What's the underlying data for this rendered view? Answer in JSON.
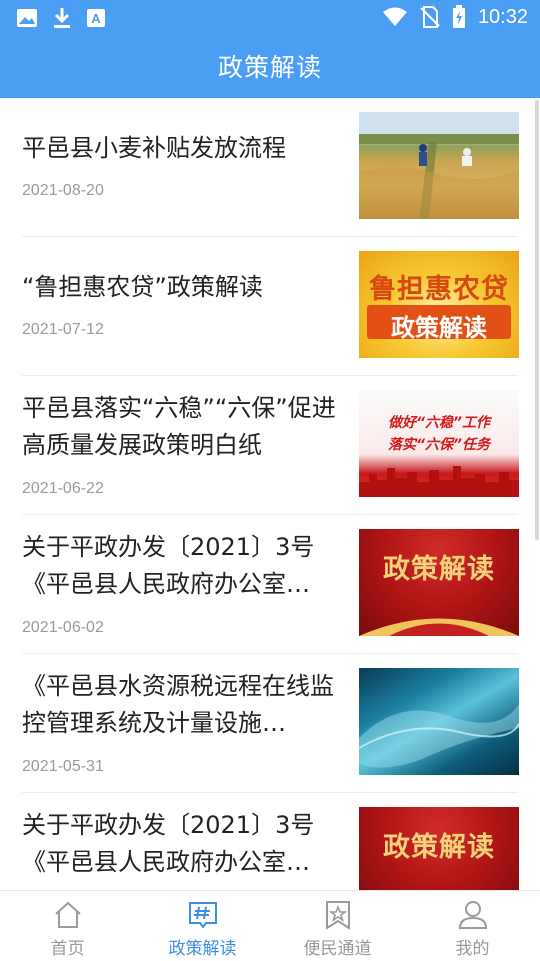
{
  "status_bar": {
    "time": "10:32",
    "icons": [
      "image-icon",
      "download-icon",
      "a-icon",
      "wifi-icon",
      "no-sim-icon",
      "battery-charging-icon"
    ]
  },
  "header": {
    "title": "政策解读"
  },
  "colors": {
    "primary": "#4a9ef4",
    "active_tab": "#3b8fe6",
    "date_gray": "#9a9a9a"
  },
  "articles": [
    {
      "title": "平邑县小麦补贴发放流程",
      "date": "2021-08-20",
      "thumb": "wheat-field-photo"
    },
    {
      "title": "“鲁担惠农贷”政策解读",
      "date": "2021-07-12",
      "thumb": "gold-banner",
      "thumb_text": [
        "鲁担惠农贷",
        "政策解读"
      ]
    },
    {
      "title": "平邑县落实“六稳”“六保”促进高质量发展政策明白纸",
      "date": "2021-06-22",
      "thumb": "red-city-banner",
      "thumb_text": [
        "做好“六稳”工作",
        "落实“六保”任务"
      ]
    },
    {
      "title": "关于平政办发〔2021〕3号《平邑县人民政府办公室…",
      "date": "2021-06-02",
      "thumb": "red-policy-banner",
      "thumb_text": [
        "政策解读"
      ]
    },
    {
      "title": "《平邑县水资源税远程在线监控管理系统及计量设施…",
      "date": "2021-05-31",
      "thumb": "water-wave-photo"
    },
    {
      "title": "关于平政办发〔2021〕3号《平邑县人民政府办公室…",
      "date": "",
      "thumb": "red-policy-banner",
      "thumb_text": [
        "政策解读"
      ]
    }
  ],
  "bottom_nav": [
    {
      "label": "首页",
      "icon": "home-icon",
      "active": false
    },
    {
      "label": "政策解读",
      "icon": "hashtag-icon",
      "active": true
    },
    {
      "label": "便民通道",
      "icon": "bookmark-star-icon",
      "active": false
    },
    {
      "label": "我的",
      "icon": "user-icon",
      "active": false
    }
  ]
}
